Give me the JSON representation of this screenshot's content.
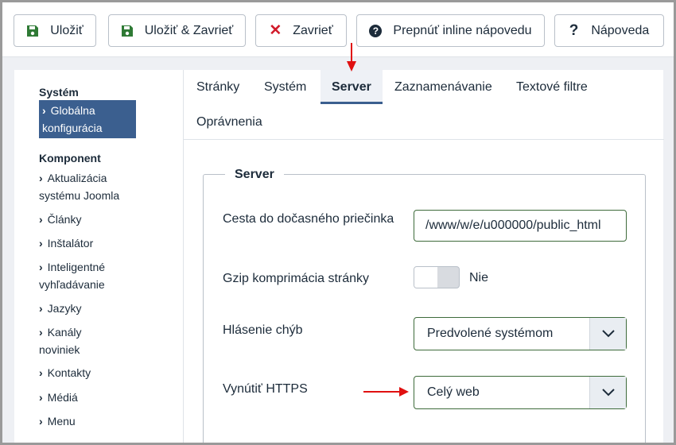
{
  "toolbar": {
    "save_label": "Uložiť",
    "save_close_label": "Uložiť & Zavrieť",
    "close_label": "Zavrieť",
    "toggle_help_label": "Prepnúť inline nápovedu",
    "help_label": "Nápoveda"
  },
  "sidebar": {
    "system_heading": "Systém",
    "active_item": "Globálna konfigurácia",
    "component_heading": "Komponent",
    "items": [
      {
        "label": "Aktualizácia systému Joomla"
      },
      {
        "label": "Články"
      },
      {
        "label": "Inštalátor"
      },
      {
        "label": "Inteligentné vyhľadávanie"
      },
      {
        "label": "Jazyky"
      },
      {
        "label": "Kanály noviniek"
      },
      {
        "label": "Kontakty"
      },
      {
        "label": "Médiá"
      },
      {
        "label": "Menu"
      }
    ]
  },
  "tabs": [
    {
      "label": "Stránky"
    },
    {
      "label": "Systém"
    },
    {
      "label": "Server"
    },
    {
      "label": "Zaznamenávanie"
    },
    {
      "label": "Textové filtre"
    },
    {
      "label": "Oprávnenia"
    }
  ],
  "server": {
    "legend": "Server",
    "temp_path": {
      "label": "Cesta do dočasného priečinka",
      "value": "/www/w/e/u000000/public_html"
    },
    "gzip": {
      "label": "Gzip komprimácia stránky",
      "state": "Nie"
    },
    "error_reporting": {
      "label": "Hlásenie chýb",
      "value": "Predvolené systémom"
    },
    "force_https": {
      "label": "Vynútiť HTTPS",
      "value": "Celý web"
    }
  },
  "colors": {
    "accent": "#3b5f8f",
    "save_icon": "#2f7a35",
    "close_icon": "#d11a2a",
    "annotation_arrow": "#e01010"
  }
}
